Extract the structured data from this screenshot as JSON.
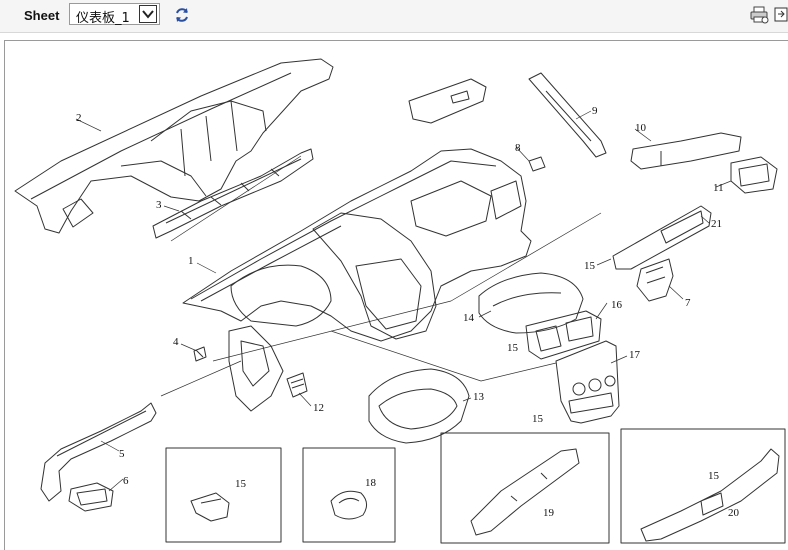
{
  "toolbar": {
    "sheet_label": "Sheet",
    "sheet_value": "仪表板_1",
    "refresh_icon": "refresh-icon",
    "print_icon": "printer-icon",
    "export_icon": "export-icon"
  },
  "diagram": {
    "callouts": [
      "1",
      "2",
      "3",
      "4",
      "5",
      "6",
      "7",
      "8",
      "9",
      "10",
      "11",
      "12",
      "13",
      "14",
      "15",
      "15",
      "15",
      "15",
      "15",
      "16",
      "17",
      "18",
      "19",
      "20",
      "21"
    ]
  },
  "colors": {
    "line": "#333333",
    "accent_icon": "#2a4fa0",
    "toolbar_bg": "#f5f5f5"
  }
}
